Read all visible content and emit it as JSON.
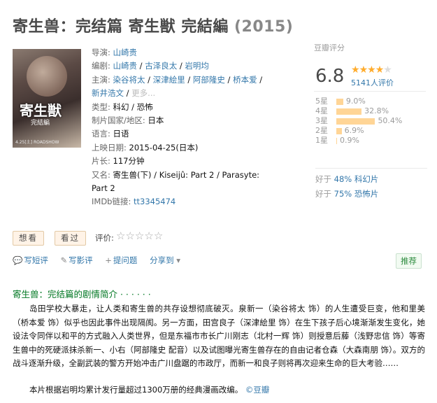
{
  "title": {
    "name": "寄生兽：完结篇 寄生獣 完結編",
    "year": "(2015)"
  },
  "poster": {
    "title": "寄生獣",
    "subtitle": "完結編",
    "date": "4.25[土] ROADSHOW"
  },
  "info": {
    "director_label": "导演:",
    "director": "山崎贵",
    "writer_label": "编剧:",
    "writers": [
      "山崎贵",
      "古泽良太",
      "岩明均"
    ],
    "cast_label": "主演:",
    "cast": [
      "染谷将太",
      "深津絵里",
      "阿部隆史",
      "桥本爱",
      "新井浩文"
    ],
    "more": "更多...",
    "genre_label": "类型:",
    "genre": "科幻 / 恐怖",
    "country_label": "制片国家/地区:",
    "country": "日本",
    "lang_label": "语言:",
    "lang": "日语",
    "release_label": "上映日期:",
    "release": "2015-04-25(日本)",
    "runtime_label": "片长:",
    "runtime": "117分钟",
    "aka_label": "又名:",
    "aka": "寄生兽(下) / Kiseijû: Part 2 / Parasyte: Part 2",
    "imdb_label": "IMDb链接:",
    "imdb": "tt3345474"
  },
  "rating": {
    "header": "豆瓣评分",
    "score": "6.8",
    "stars_fraction": 0.68,
    "count": "5141人评价",
    "dist": [
      {
        "label": "5星",
        "pct": "9.0%",
        "value": 9.0
      },
      {
        "label": "4星",
        "pct": "32.8%",
        "value": 32.8
      },
      {
        "label": "3星",
        "pct": "50.4%",
        "value": 50.4
      },
      {
        "label": "2星",
        "pct": "6.9%",
        "value": 6.9
      },
      {
        "label": "1星",
        "pct": "0.9%",
        "value": 0.9
      }
    ],
    "better1_pre": "好于 ",
    "better1_link": "48% 科幻片",
    "better2_pre": "好于 ",
    "better2_link": "75% 恐怖片"
  },
  "actions": {
    "want": "想看",
    "watched": "看过",
    "rate_label": "评价:",
    "short_review": "写短评",
    "review": "写影评",
    "ask": "提问题",
    "share": "分享到",
    "recommend": "推荐"
  },
  "summary": {
    "title": "寄生兽：完结篇的剧情简介 · · · · · ·",
    "text": "岛田学校大暴走，让人类和寄生兽的共存设想彻底破灭。泉新一（染谷将太 饰）的人生遭受巨变，他和里美（桥本爱 饰）似乎也因此事件出现隔阂。另一方面，田宫良子（深津絵里 饰）在生下孩子后心境渐渐发生变化，她设法令同伴以和平的方式融入人类世界，但是东福市市长广川刚志（北村一辉 饰）则授意后藤（浅野忠信 饰）等寄生兽中的死硬派抹杀新一、小右（阿部隆史 配音）以及试图曝光寄生兽存在的自由记者仓森（大森南朋 饰）。双方的战斗逐渐升级，全副武装的警方开始冲击广川盘踞的市政厅，而新一和良子则将再次迎来生命的巨大考验……",
    "text2": "本片根据岩明均累计发行量超过1300万册的经典漫画改编。",
    "credit": "©豆瓣"
  }
}
